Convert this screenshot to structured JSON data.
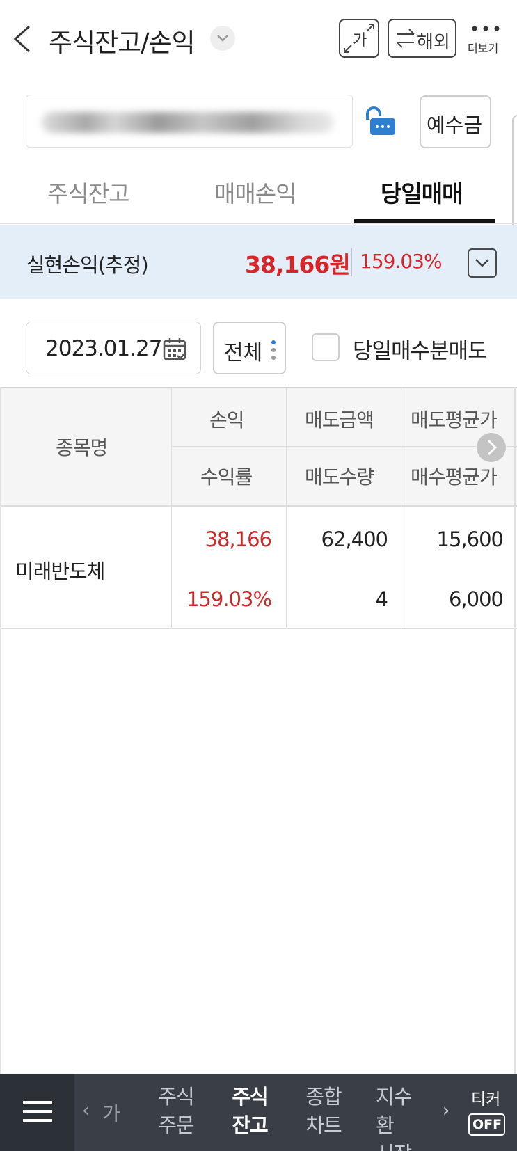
{
  "header": {
    "title": "주식잔고/손익",
    "font_size_button": "가",
    "overseas_button": "해외",
    "more_label": "더보기"
  },
  "account": {
    "deposit_button": "예수금"
  },
  "tabs": [
    {
      "label": "주식잔고",
      "active": false
    },
    {
      "label": "매매손익",
      "active": false
    },
    {
      "label": "당일매매",
      "active": true
    }
  ],
  "realized_pl": {
    "label": "실현손익(추정)",
    "amount": "38,166원",
    "rate": "159.03%"
  },
  "filter": {
    "date": "2023.01.27",
    "scope": "전체",
    "checkbox_label": "당일매수분매도",
    "checkbox_checked": false
  },
  "table": {
    "headers": {
      "name": "종목명",
      "pl": "손익",
      "rate": "수익률",
      "sell_amount": "매도금액",
      "sell_qty": "매도수량",
      "sell_avg": "매도평균가",
      "buy_avg": "매수평균가"
    },
    "rows": [
      {
        "name": "미래반도체",
        "pl": "38,166",
        "rate": "159.03%",
        "sell_amount": "62,400",
        "sell_qty": "4",
        "sell_avg": "15,600",
        "buy_avg": "6,000"
      }
    ]
  },
  "bottom_nav": {
    "prev_label": "가",
    "items": [
      {
        "line1": "주식",
        "line2": "주문",
        "active": false
      },
      {
        "line1": "주식",
        "line2": "잔고",
        "active": true
      },
      {
        "line1": "종합",
        "line2": "차트",
        "active": false
      },
      {
        "line1": "지수환",
        "line2": "시장지",
        "active": false
      }
    ],
    "ticker_label": "티커",
    "ticker_state": "OFF"
  },
  "colors": {
    "profit_red": "#d7262a",
    "pl_row_bg": "#e4eef8",
    "nav_bg": "#3a3f47",
    "lock_blue": "#2f7fd0"
  }
}
